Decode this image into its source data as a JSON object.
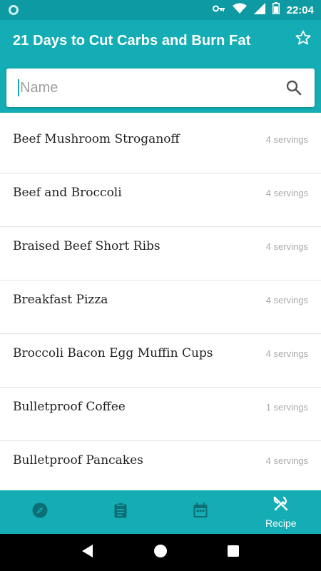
{
  "status_bar": {
    "time": "22:04",
    "icons": [
      "app-notification-icon",
      "vpn-key-icon",
      "wifi-icon",
      "signal-icon",
      "battery-icon"
    ]
  },
  "app_bar": {
    "title": "21 Days to Cut Carbs and Burn Fat",
    "favorite_icon": "star-outline-icon"
  },
  "search": {
    "placeholder": "Name",
    "value": ""
  },
  "recipes": [
    {
      "name": "Beef Mushroom Stroganoff",
      "servings": "4 servings"
    },
    {
      "name": "Beef and Broccoli",
      "servings": "4 servings"
    },
    {
      "name": "Braised Beef Short Ribs",
      "servings": "4 servings"
    },
    {
      "name": "Breakfast Pizza",
      "servings": "4 servings"
    },
    {
      "name": "Broccoli Bacon Egg Muffin Cups",
      "servings": "4 servings"
    },
    {
      "name": "Bulletproof Coffee",
      "servings": "1 servings"
    },
    {
      "name": "Bulletproof Pancakes",
      "servings": "4 servings"
    }
  ],
  "bottom_nav": {
    "items": [
      {
        "icon": "compass-icon",
        "label": ""
      },
      {
        "icon": "clipboard-icon",
        "label": ""
      },
      {
        "icon": "calendar-icon",
        "label": ""
      },
      {
        "icon": "fork-knife-icon",
        "label": "Recipe",
        "active": true
      }
    ]
  },
  "colors": {
    "primary": "#14adb5",
    "primary_dark": "#0e9aa2",
    "servings_text": "#a8a8a8",
    "divider": "#e2e2e2"
  }
}
